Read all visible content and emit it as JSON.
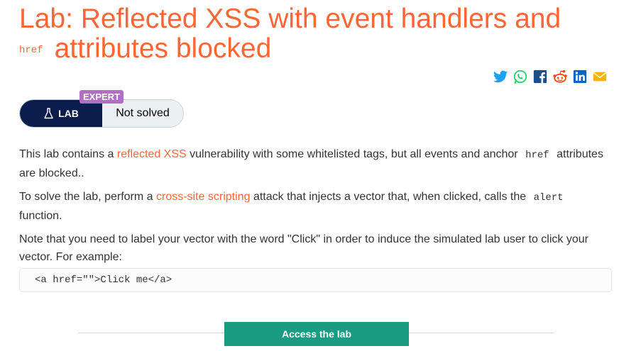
{
  "header": {
    "title": "Lab: Reflected XSS with event handlers and",
    "title_code": "href",
    "title_rest": "attributes blocked"
  },
  "share_icons": [
    "twitter-icon",
    "whatsapp-icon",
    "facebook-icon",
    "reddit-icon",
    "linkedin-icon",
    "email-icon"
  ],
  "status": {
    "level": "EXPERT",
    "lab_label": "LAB",
    "state": "Not solved"
  },
  "description": {
    "p1_before": "This lab contains a",
    "p1_link": "reflected XSS",
    "p1_mid": "vulnerability with some whitelisted tags, but all events and anchor",
    "p1_code": "href",
    "p1_after": "attributes are blocked..",
    "p2_before": "To solve the lab, perform a",
    "p2_link": "cross-site scripting",
    "p2_mid": "attack that injects a vector that, when clicked, calls the",
    "p2_code": "alert",
    "p2_after": "function.",
    "p3": "Note that you need to label your vector with the word \"Click\" in order to induce the simulated lab user to click your vector. For example:"
  },
  "example_code": "<a href=\"\">Click me</a>",
  "access_button": "Access the lab",
  "colors": {
    "accent": "#ff6633",
    "lab_navy": "#0a1d4d",
    "expert_purple": "#b06ec5",
    "button_green": "#1a9c83"
  }
}
